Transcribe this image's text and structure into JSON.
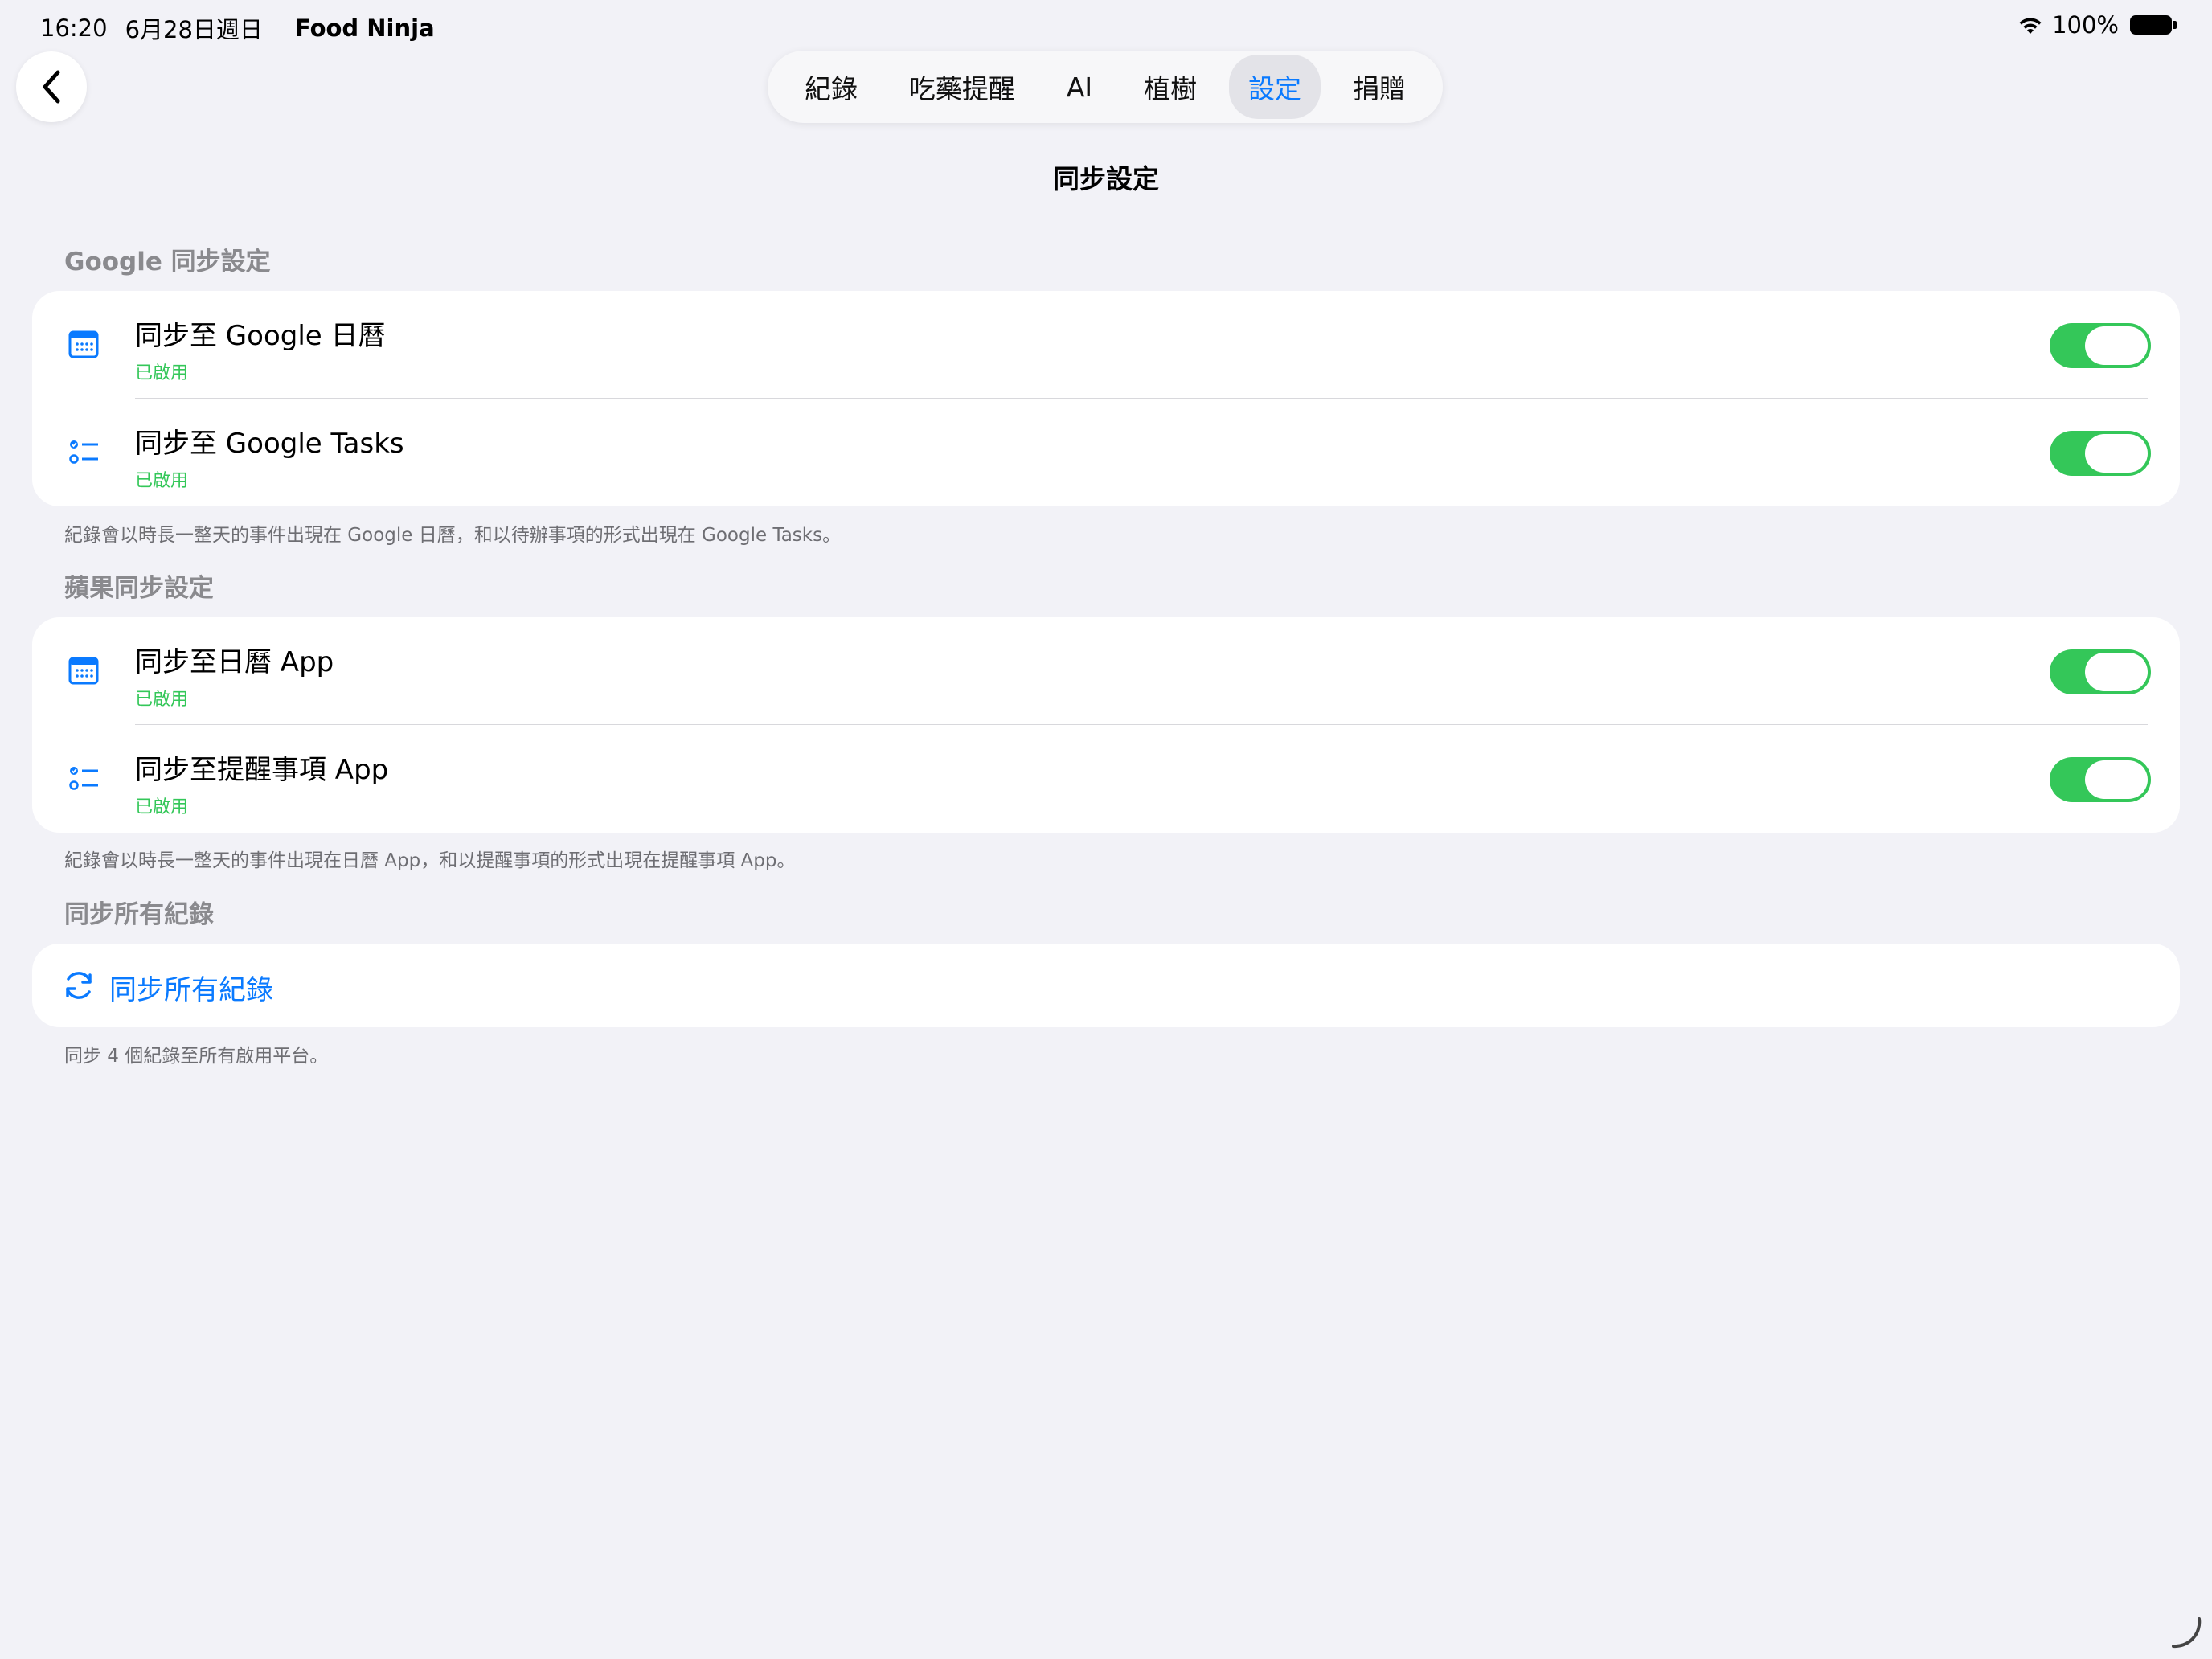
{
  "status_bar": {
    "time": "16:20",
    "date": "6月28日週日",
    "app_name": "Food Ninja",
    "battery": "100%"
  },
  "nav": {
    "back_icon": "chevron-left-icon",
    "tabs": [
      {
        "label": "紀錄",
        "active": false
      },
      {
        "label": "吃藥提醒",
        "active": false
      },
      {
        "label": "AI",
        "active": false
      },
      {
        "label": "植樹",
        "active": false
      },
      {
        "label": "設定",
        "active": true
      },
      {
        "label": "捐贈",
        "active": false
      }
    ]
  },
  "page": {
    "title": "同步設定"
  },
  "google": {
    "header": "Google 同步設定",
    "rows": [
      {
        "icon": "calendar-icon",
        "title": "同步至 Google 日曆",
        "status": "已啟用",
        "enabled": true
      },
      {
        "icon": "checklist-icon",
        "title": "同步至 Google Tasks",
        "status": "已啟用",
        "enabled": true
      }
    ],
    "footnote": "紀錄會以時長一整天的事件出現在 Google 日曆，和以待辦事項的形式出現在 Google Tasks。"
  },
  "apple": {
    "header": "蘋果同步設定",
    "rows": [
      {
        "icon": "calendar-icon",
        "title": "同步至日曆 App",
        "status": "已啟用",
        "enabled": true
      },
      {
        "icon": "checklist-icon",
        "title": "同步至提醒事項 App",
        "status": "已啟用",
        "enabled": true
      }
    ],
    "footnote": "紀錄會以時長一整天的事件出現在日曆 App，和以提醒事項的形式出現在提醒事項 App。"
  },
  "sync_all": {
    "header": "同步所有紀錄",
    "action_label": "同步所有紀錄",
    "icon": "sync-icon",
    "footnote": "同步 4 個紀錄至所有啟用平台。"
  },
  "colors": {
    "accent": "#0a7aff",
    "toggle_on": "#34c759",
    "background": "#f2f2f7"
  }
}
